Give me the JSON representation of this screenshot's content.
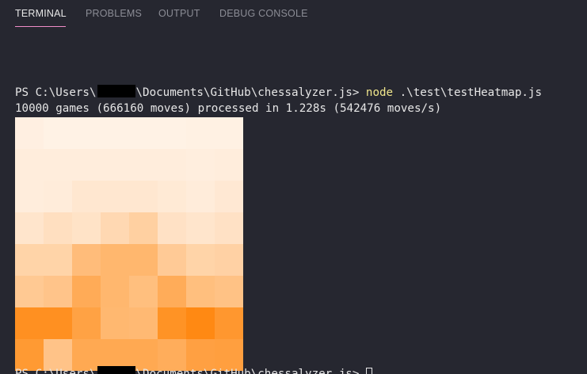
{
  "tabs": [
    {
      "label": "TERMINAL",
      "active": true
    },
    {
      "label": "PROBLEMS",
      "active": false
    },
    {
      "label": "OUTPUT",
      "active": false
    },
    {
      "label": "DEBUG CONSOLE",
      "active": false
    }
  ],
  "terminal": {
    "prompt_before_redaction": "PS C:\\Users\\",
    "prompt_after_redaction": "\\Documents\\GitHub\\chessalyzer.js> ",
    "command": "node",
    "args": " .\\test\\testHeatmap.js",
    "output_line": "10000 games (666160 moves) processed in 1.228s (542476 moves/s)",
    "bottom_prompt_partial": "PS C:\\Users\\",
    "bottom_prompt_partial_after": "\\Documents\\GitHub\\chessalyzer.js> "
  },
  "colors": {
    "background": "#262730",
    "text": "#e7e7e7",
    "command": "#f0e68c",
    "tab_active_underline": "#f08dc8",
    "tab_inactive": "#8b8c95",
    "heat_low": "#fff4ea",
    "heat_high": "#ff8000"
  },
  "heatmap": {
    "rows": 8,
    "cols": 8,
    "values": [
      [
        0.04,
        0.02,
        0.02,
        0.02,
        0.02,
        0.02,
        0.03,
        0.03
      ],
      [
        0.06,
        0.06,
        0.06,
        0.06,
        0.06,
        0.06,
        0.05,
        0.06
      ],
      [
        0.06,
        0.07,
        0.11,
        0.11,
        0.11,
        0.09,
        0.07,
        0.1
      ],
      [
        0.13,
        0.18,
        0.15,
        0.24,
        0.31,
        0.16,
        0.13,
        0.16
      ],
      [
        0.28,
        0.28,
        0.48,
        0.53,
        0.53,
        0.36,
        0.28,
        0.3
      ],
      [
        0.37,
        0.41,
        0.63,
        0.53,
        0.46,
        0.62,
        0.46,
        0.43
      ],
      [
        0.86,
        0.86,
        0.71,
        0.52,
        0.51,
        0.84,
        0.92,
        0.8
      ],
      [
        0.78,
        0.42,
        0.65,
        0.65,
        0.65,
        0.61,
        0.72,
        0.73
      ]
    ]
  }
}
